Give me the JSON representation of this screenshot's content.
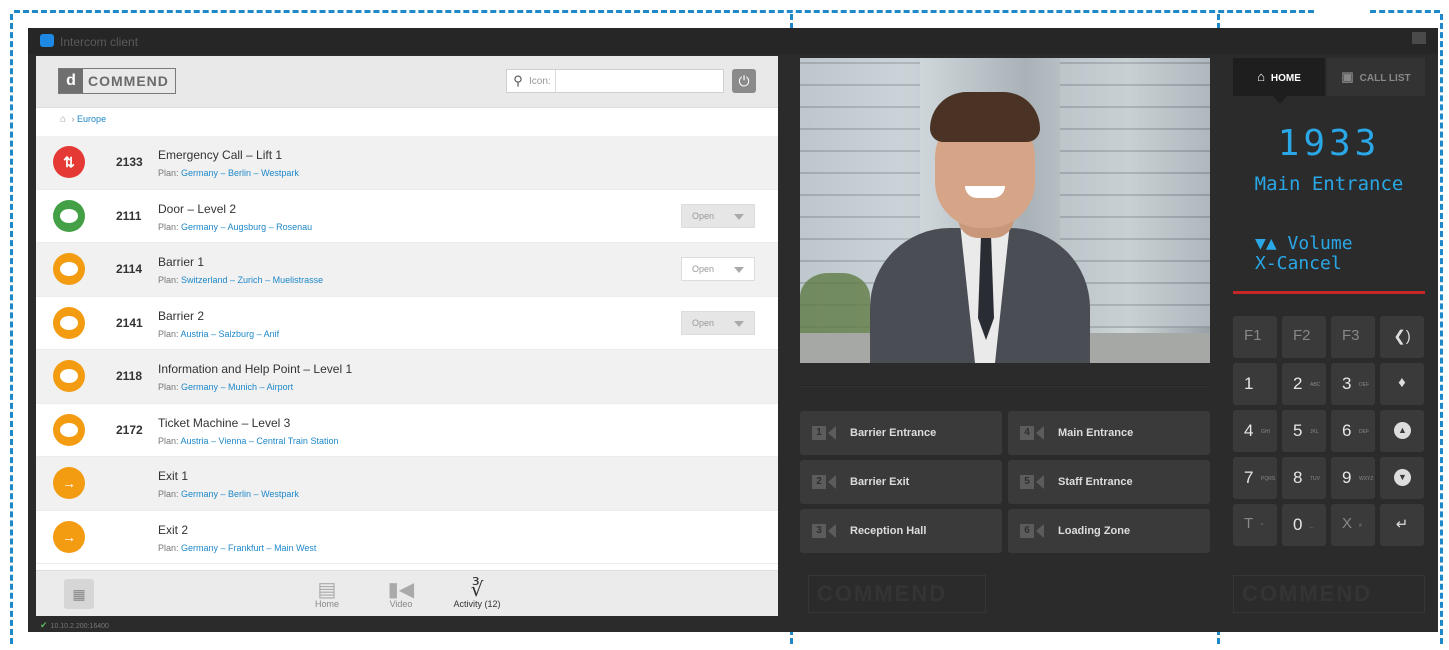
{
  "window": {
    "title": "Intercom client"
  },
  "brand": {
    "mark": "d",
    "name": "COMMEND"
  },
  "search": {
    "label": "Icon:",
    "value": "",
    "placeholder": ""
  },
  "breadcrumb": {
    "item": "Europe"
  },
  "plan_prefix": "Plan:",
  "rows": [
    {
      "number": "2133",
      "name": "Emergency Call – Lift 1",
      "location": "Germany – Berlin – Westpark",
      "status": ""
    },
    {
      "number": "2111",
      "name": "Door – Level 2",
      "location": "Germany – Augsburg – Rosenau",
      "status": "Open"
    },
    {
      "number": "2114",
      "name": "Barrier 1",
      "location": "Switzerland – Zurich – Muelistrasse",
      "status": "Open"
    },
    {
      "number": "2141",
      "name": "Barrier 2",
      "location": "Austria – Salzburg – Anif",
      "status": "Open"
    },
    {
      "number": "2118",
      "name": "Information and Help Point – Level 1",
      "location": "Germany – Munich – Airport",
      "status": ""
    },
    {
      "number": "2172",
      "name": "Ticket Machine – Level 3",
      "location": "Austria – Vienna – Central Train Station",
      "status": ""
    },
    {
      "number": "",
      "name": "Exit 1",
      "location": "Germany – Berlin – Westpark",
      "status": ""
    },
    {
      "number": "",
      "name": "Exit 2",
      "location": "Germany – Frankfurt – Main West",
      "status": ""
    }
  ],
  "footer_tabs": {
    "home": "Home",
    "video": "Video",
    "activity": "Activity (12)"
  },
  "status": {
    "text": "10.10.2.200:16400"
  },
  "destinations": [
    {
      "num": "1",
      "label": "Barrier Entrance"
    },
    {
      "num": "4",
      "label": "Main Entrance"
    },
    {
      "num": "2",
      "label": "Barrier Exit"
    },
    {
      "num": "5",
      "label": "Staff Entrance"
    },
    {
      "num": "3",
      "label": "Reception Hall"
    },
    {
      "num": "6",
      "label": "Loading Zone"
    }
  ],
  "right_tabs": {
    "home": "HOME",
    "calls": "CALL LIST"
  },
  "display": {
    "number": "1933",
    "name": "Main Entrance",
    "line1": "▼▲ Volume",
    "line2": "X-Cancel"
  },
  "keypad": {
    "f1": "F1",
    "f2": "F2",
    "f3": "F3",
    "k1": "1",
    "k2": "2",
    "k2s": "ABC",
    "k3": "3",
    "k3s": "DEF",
    "k4": "4",
    "k4s": "GHI",
    "k5": "5",
    "k5s": "JKL",
    "k6": "6",
    "k6s": "DEF",
    "k7": "7",
    "k7s": "PQRS",
    "k8": "8",
    "k8s": "TUV",
    "k9": "9",
    "k9s": "WXYZ",
    "kt": "T",
    "kts": "*",
    "k0": "0",
    "k0s": "_",
    "kx": "X",
    "kxs": "#"
  },
  "colors": {
    "accent": "#1e88c9",
    "emergency": "#e53935",
    "connected": "#43a047",
    "waiting": "#f39c12",
    "display": "#2aa7e6"
  }
}
